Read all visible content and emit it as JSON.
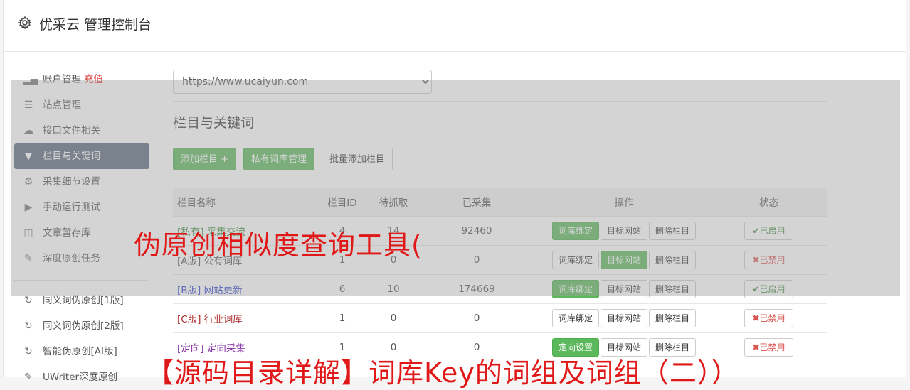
{
  "header": {
    "title": "优采云 管理控制台"
  },
  "sidebar": {
    "items": [
      {
        "label": "账户管理",
        "extra": "充值",
        "icon": "bar-chart-icon"
      },
      {
        "label": "站点管理",
        "icon": "server-icon"
      },
      {
        "label": "接口文件相关",
        "icon": "cloud-upload-icon"
      },
      {
        "label": "栏目与关键词",
        "icon": "filter-icon",
        "active": true
      },
      {
        "label": "采集细节设置",
        "icon": "gears-icon"
      },
      {
        "label": "手动运行测试",
        "icon": "play-icon"
      },
      {
        "label": "文章暂存库",
        "icon": "database-icon"
      },
      {
        "label": "深度原创任务",
        "icon": "edit-icon"
      }
    ],
    "items2": [
      {
        "label": "同义词伪原创[1版]",
        "icon": "refresh-icon"
      },
      {
        "label": "同义词伪原创[2版]",
        "icon": "refresh-icon"
      },
      {
        "label": "智能伪原创[AI版]",
        "icon": "refresh-icon"
      },
      {
        "label": "UWriter深度原创",
        "icon": "edit-icon"
      }
    ]
  },
  "main": {
    "site_select": "https://www.ucaiyun.com",
    "section_title": "栏目与关键词",
    "buttons": {
      "add": "添加栏目 +",
      "private": "私有词库管理",
      "batch": "批量添加栏目"
    },
    "table": {
      "headers": [
        "栏目名称",
        "栏目ID",
        "待抓取",
        "已采集",
        "操作",
        "状态"
      ],
      "rows": [
        {
          "name": "[私有] 采集交流",
          "id": "4",
          "pending": "14",
          "collected": "92460",
          "op1": "词库绑定",
          "op2": "目标网站",
          "op3": "删除栏目",
          "status": "✔已启用"
        },
        {
          "name": "[A版] 公有词库",
          "id": "1",
          "pending": "0",
          "collected": "0",
          "op1": "词库绑定",
          "op2": "目标网站",
          "op3": "删除栏目",
          "status": "✖已禁用"
        },
        {
          "name": "[B版] 网站更新",
          "id": "6",
          "pending": "10",
          "collected": "174669",
          "op1": "词库绑定",
          "op2": "目标网站",
          "op3": "删除栏目",
          "status": "✔已启用"
        },
        {
          "name": "[C版] 行业词库",
          "id": "1",
          "pending": "0",
          "collected": "0",
          "op1": "词库绑定",
          "op2": "目标网站",
          "op3": "删除栏目",
          "status": "✖已禁用"
        },
        {
          "name": "[定向] 定向采集",
          "id": "1",
          "pending": "0",
          "collected": "0",
          "op1": "定向设置",
          "op2": "目标网站",
          "op3": "删除栏目",
          "status": "✖已禁用"
        }
      ]
    }
  },
  "watermark": {
    "line1": "伪原创相似度查询工具(",
    "line2": "【源码目录详解】词库Key的词组及词组（二））"
  }
}
